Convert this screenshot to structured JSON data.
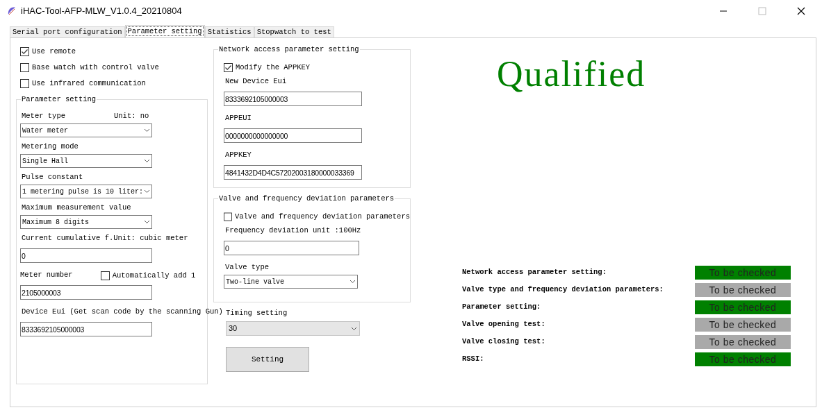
{
  "window": {
    "title": "iHAC-Tool-AFP-MLW_V1.0.4_20210804"
  },
  "tabs": [
    {
      "label": "Serial port configuration",
      "selected": false
    },
    {
      "label": "Parameter setting",
      "selected": true
    },
    {
      "label": "Statistics",
      "selected": false
    },
    {
      "label": "Stopwatch to test",
      "selected": false
    }
  ],
  "options": [
    {
      "label": "Use remote",
      "checked": true
    },
    {
      "label": "Base watch with control valve",
      "checked": false
    },
    {
      "label": "Use infrared communication",
      "checked": false
    }
  ],
  "parameter_setting": {
    "title": "Parameter setting",
    "items": [
      {
        "kind": "label",
        "label": "Meter type",
        "note": "Unit: no"
      },
      {
        "kind": "combo",
        "value": "Water meter"
      },
      {
        "kind": "label",
        "label": "Metering mode"
      },
      {
        "kind": "combo",
        "value": "Single Hall"
      },
      {
        "kind": "label",
        "label": "Pulse constant"
      },
      {
        "kind": "combo",
        "value": "1 metering pulse is 10 liter:"
      },
      {
        "kind": "label",
        "label": "Maximum measurement value"
      },
      {
        "kind": "combo",
        "value": "Maximum 8 digits"
      },
      {
        "kind": "label",
        "label": "Current cumulative f.Unit: cubic meter"
      },
      {
        "kind": "input",
        "value": "0"
      },
      {
        "kind": "label_check",
        "label": "Meter number",
        "check_label": "Automatically add 1",
        "checked": false
      },
      {
        "kind": "input",
        "value": "2105000003"
      },
      {
        "kind": "label",
        "label": "Device Eui (Get scan code by the scanning Gun)"
      },
      {
        "kind": "input",
        "value": "8333692105000003"
      }
    ]
  },
  "network_access": {
    "title": "Network access parameter setting",
    "items": [
      {
        "kind": "check",
        "label": "Modify the APPKEY",
        "checked": true
      },
      {
        "kind": "label",
        "label": "New Device Eui"
      },
      {
        "kind": "input",
        "value": "8333692105000003"
      },
      {
        "kind": "label",
        "label": "APPEUI"
      },
      {
        "kind": "input",
        "value": "0000000000000000"
      },
      {
        "kind": "label",
        "label": "APPKEY"
      },
      {
        "kind": "input",
        "value": "4841432D4D4C57202003180000033369"
      }
    ]
  },
  "valve_frequency": {
    "title": "Valve and frequency deviation parameters",
    "items": [
      {
        "kind": "check",
        "label": "Valve and frequency deviation parameters",
        "checked": false
      },
      {
        "kind": "label",
        "label": "Frequency deviation unit :100Hz"
      },
      {
        "kind": "input",
        "value": "0"
      },
      {
        "kind": "label",
        "label": "Valve type"
      },
      {
        "kind": "combo",
        "value": "Two-line valve"
      }
    ]
  },
  "timing": {
    "label": "Timing setting",
    "value": "30"
  },
  "setting_button": "Setting",
  "result": "Qualified",
  "checks": [
    {
      "label": "Network access parameter setting:",
      "status": "To be checked",
      "color": "#008000"
    },
    {
      "label": "Valve type and frequency deviation parameters:",
      "status": "To be checked",
      "color": "#a9a9a9"
    },
    {
      "label": "Parameter setting:",
      "status": "To be checked",
      "color": "#008000"
    },
    {
      "label": "Valve opening test:",
      "status": "To be checked",
      "color": "#a9a9a9"
    },
    {
      "label": "Valve closing test:",
      "status": "To be checked",
      "color": "#a9a9a9"
    },
    {
      "label": "RSSI:",
      "status": "To be checked",
      "color": "#008000"
    }
  ]
}
